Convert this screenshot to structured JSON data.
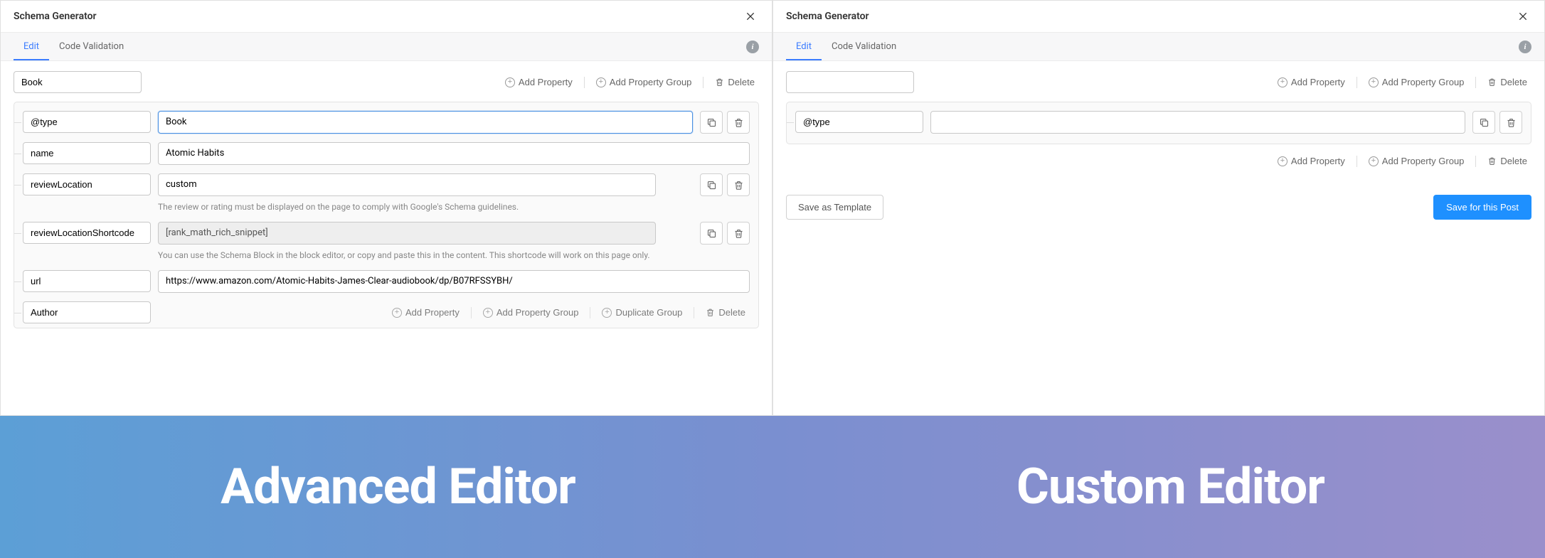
{
  "left": {
    "title": "Schema Generator",
    "tabs": {
      "edit": "Edit",
      "validation": "Code Validation"
    },
    "schemaName": "Book",
    "actions": {
      "addProp": "Add Property",
      "addGroup": "Add Property Group",
      "delete": "Delete",
      "dupGroup": "Duplicate Group"
    },
    "rows": {
      "type": {
        "key": "@type",
        "val": "Book"
      },
      "name": {
        "key": "name",
        "val": "Atomic Habits"
      },
      "reviewLocation": {
        "key": "reviewLocation",
        "val": "custom",
        "hint": "The review or rating must be displayed on the page to comply with Google's Schema guidelines."
      },
      "reviewLocationShortcode": {
        "key": "reviewLocationShortcode",
        "val": "[rank_math_rich_snippet]",
        "hint": "You can use the Schema Block in the block editor, or copy and paste this in the content. This shortcode will work on this page only."
      },
      "url": {
        "key": "url",
        "val": "https://www.amazon.com/Atomic-Habits-James-Clear-audiobook/dp/B07RFSSYBH/"
      },
      "author": {
        "key": "Author"
      }
    }
  },
  "right": {
    "title": "Schema Generator",
    "tabs": {
      "edit": "Edit",
      "validation": "Code Validation"
    },
    "schemaName": "",
    "actions": {
      "addProp": "Add Property",
      "addGroup": "Add Property Group",
      "delete": "Delete"
    },
    "rows": {
      "type": {
        "key": "@type",
        "val": ""
      }
    },
    "footer": {
      "saveTemplate": "Save as Template",
      "savePost": "Save for this Post"
    }
  },
  "banner": {
    "left": "Advanced Editor",
    "right": "Custom Editor"
  }
}
